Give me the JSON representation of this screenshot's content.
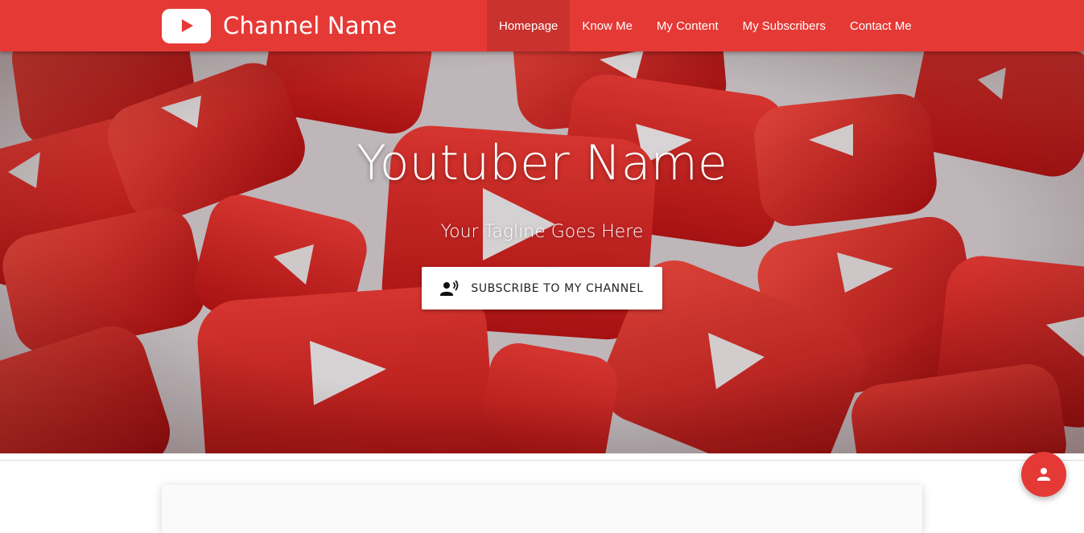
{
  "navbar": {
    "brand_name": "Channel Name",
    "brand_icon": "youtube-logo-icon",
    "links": [
      {
        "label": "Homepage",
        "active": true
      },
      {
        "label": "Know Me",
        "active": false
      },
      {
        "label": "My Content",
        "active": false
      },
      {
        "label": "My Subscribers",
        "active": false
      },
      {
        "label": "Contact Me",
        "active": false
      }
    ]
  },
  "hero": {
    "title": "Youtuber Name",
    "tagline": "Your Tagline Goes Here",
    "button": {
      "label": "SUBSCRIBE TO MY CHANNEL",
      "icon": "record-voice-icon"
    }
  },
  "fab": {
    "icon": "person-icon"
  },
  "colors": {
    "primary": "#e53935",
    "background": "#ffffff",
    "card": "#fafafa"
  }
}
